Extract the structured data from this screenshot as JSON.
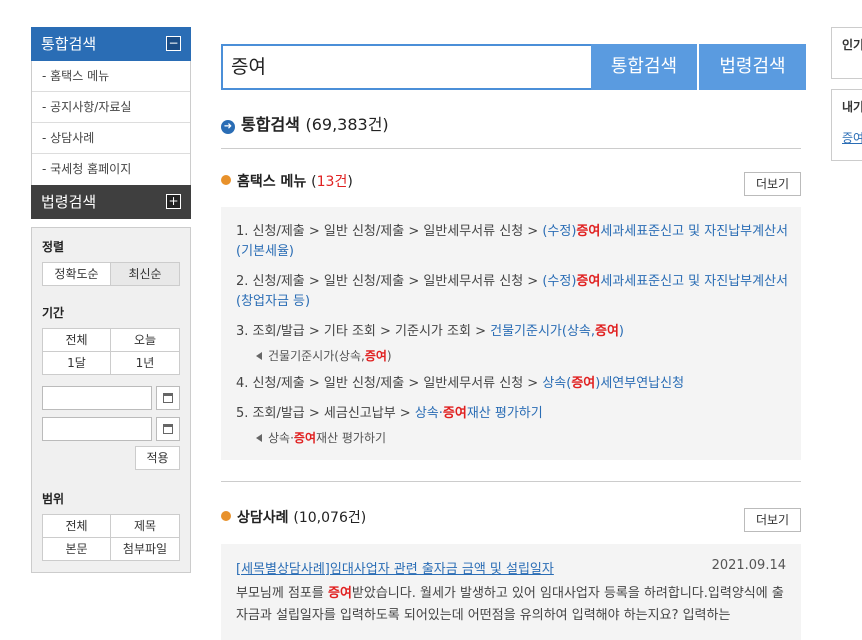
{
  "sidebar": {
    "integrated_search": "통합검색",
    "integrated_toggle": "−",
    "items": [
      "- 홈택스 메뉴",
      "- 공지사항/자료실",
      "- 상담사례",
      "- 국세청 홈페이지"
    ],
    "law_search": "법령검색",
    "law_toggle": "+"
  },
  "filters": {
    "sort_label": "정렬",
    "sort_options": [
      "정확도순",
      "최신순"
    ],
    "period_label": "기간",
    "period_options": [
      "전체",
      "오늘",
      "1달",
      "1년"
    ],
    "apply_label": "적용",
    "range_label": "범위",
    "range_options": [
      "전체",
      "제목",
      "본문",
      "첨부파일"
    ]
  },
  "search": {
    "query": "증여",
    "integrated_button": "통합검색",
    "law_button": "법령검색"
  },
  "results": {
    "title": "통합검색",
    "count": "(69,383건)",
    "hometax": {
      "title": "홈택스 메뉴",
      "count_open": "(",
      "count_value": "13건",
      "count_close": ")",
      "more": "더보기",
      "items": [
        {
          "path": "1. 신청/제출 > 일반 신청/제출 > 일반세무서류 신청 >",
          "link_pre": "(수정)",
          "highlight": "증여",
          "link_post": "세과세표준신고 및 자진납부계산서(기본세율)"
        },
        {
          "path": "2. 신청/제출 > 일반 신청/제출 > 일반세무서류 신청 >",
          "link_pre": "(수정)",
          "highlight": "증여",
          "link_post": "세과세표준신고 및 자진납부계산서(창업자금 등)"
        },
        {
          "path": "3. 조회/발급 > 기타 조회 > 기준시가 조회 >",
          "link_pre": "건물기준시가(상속,",
          "highlight": "증여",
          "link_post": ")",
          "sub_pre": "건물기준시가(상속,",
          "sub_post": ")"
        },
        {
          "path": "4. 신청/제출 > 일반 신청/제출 > 일반세무서류 신청 >",
          "link_pre": "상속(",
          "highlight": "증여",
          "link_post": ")세연부연납신청"
        },
        {
          "path": "5. 조회/발급 > 세금신고납부 >",
          "link_pre": "상속·",
          "highlight": "증여",
          "link_post": "재산 평가하기",
          "sub_pre": "상속·",
          "sub_post": "재산 평가하기"
        }
      ]
    },
    "consult": {
      "title": "상담사례",
      "count": "(10,076건)",
      "more": "더보기",
      "case_title": "[세목별상담사례]임대사업자 관련 출자금 금액 및 설립일자",
      "case_date": "2021.09.14",
      "text_pre": "부모님께 점포를 ",
      "highlight": "증여",
      "text_post": "받았습니다. 월세가 발생하고 있어 임대사업자 등록을 하려합니다.입력양식에 출자금과 설립일자를 입력하도록 되어있는데 어떤점을 유의하여 입력해야 하는지요? 입력하는"
    }
  },
  "right_panel": {
    "box1_label": "인기",
    "box2_label": "내기",
    "box2_link": "증여"
  }
}
